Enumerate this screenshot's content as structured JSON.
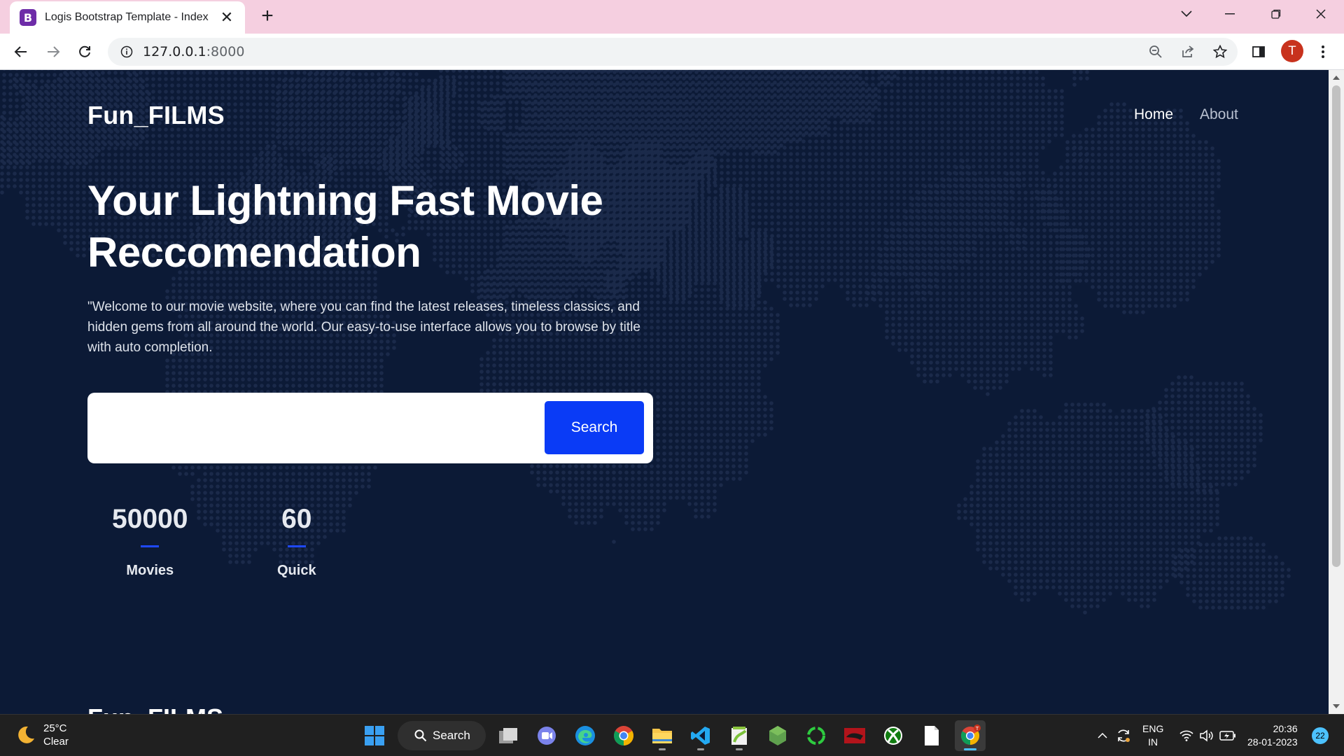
{
  "browser": {
    "tab_title": "Logis Bootstrap Template - Index",
    "favicon_letter": "B",
    "url_host": "127.0.0.1",
    "url_port": ":8000",
    "profile_initial": "T"
  },
  "site": {
    "brand": "Fun_FILMS",
    "nav": [
      {
        "label": "Home"
      },
      {
        "label": "About"
      }
    ],
    "hero": {
      "title": "Your Lightning Fast Movie Reccomendation",
      "description": "\"Welcome to our movie website, where you can find the latest releases, timeless classics, and hidden gems from all around the world. Our easy-to-use interface allows you to browse by title with auto completion."
    },
    "search": {
      "value": "",
      "placeholder": "",
      "button_label": "Search"
    },
    "stats": [
      {
        "value": "50000",
        "label": "Movies"
      },
      {
        "value": "60",
        "label": "Quick"
      }
    ],
    "footer_brand": "Fun_FILMS"
  },
  "taskbar": {
    "weather_temp": "25°C",
    "weather_desc": "Clear",
    "search_label": "Search",
    "lang_line1": "ENG",
    "lang_line2": "IN",
    "time": "20:36",
    "date": "28-01-2023",
    "notification_count": "22"
  },
  "colors": {
    "page_bg": "#0c1a36",
    "accent": "#0a3bf6",
    "tab_strip": "#f5cfe0"
  }
}
